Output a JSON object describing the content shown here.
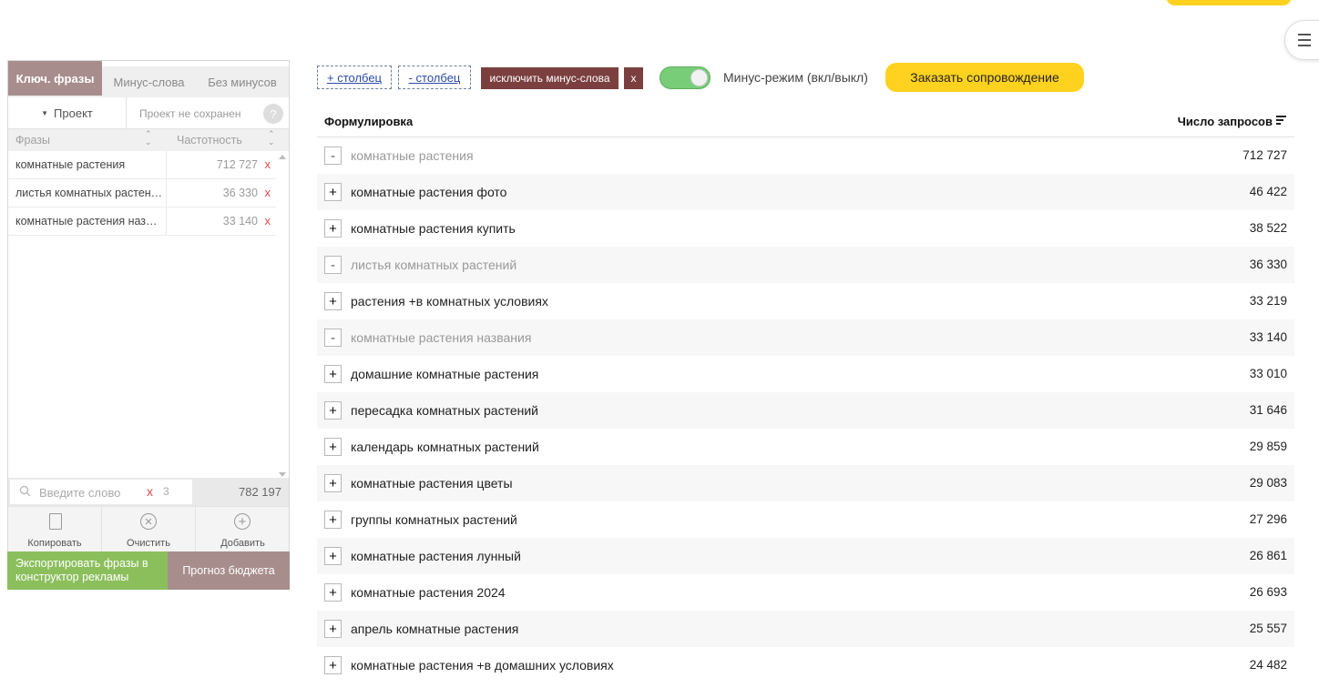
{
  "left_panel": {
    "tabs": [
      {
        "label": "Ключ. фразы",
        "active": true
      },
      {
        "label": "Минус-слова",
        "active": false
      },
      {
        "label": "Без минусов",
        "active": false
      }
    ],
    "project_button": "Проект",
    "project_status": "Проект не сохранен",
    "help": "?",
    "col_phrases": "Фразы",
    "col_frequency": "Частотность",
    "phrases": [
      {
        "text": "комнатные растения",
        "count": "712 727",
        "remove": "x"
      },
      {
        "text": "листья комнатных растений",
        "count": "36 330",
        "remove": "x"
      },
      {
        "text": "комнатные растения названия",
        "count": "33 140",
        "remove": "x"
      }
    ],
    "search": {
      "placeholder": "Введите слово",
      "clear": "x",
      "count": "3"
    },
    "total": "782 197",
    "actions": {
      "copy": "Копировать",
      "clear": "Очистить",
      "add": "Добавить"
    },
    "export_button": "Экспортировать фразы в конструктор рекламы",
    "budget_button": "Прогноз бюджета"
  },
  "toolbar": {
    "add_column": "+ столбец",
    "remove_column": "- столбец",
    "exclude_minus": "исключить минус-слова",
    "exclude_x": "x",
    "minus_mode_label": "Минус-режим (вкл/выкл)",
    "minus_mode_on": true,
    "order_button": "Заказать сопровождение"
  },
  "table": {
    "col_phrase": "Формулировка",
    "col_count": "Число запросов",
    "rows": [
      {
        "sign": "-",
        "phrase": "комнатные растения",
        "count": "712 727",
        "added": true
      },
      {
        "sign": "+",
        "phrase": "комнатные растения фото",
        "count": "46 422",
        "added": false
      },
      {
        "sign": "+",
        "phrase": "комнатные растения купить",
        "count": "38 522",
        "added": false
      },
      {
        "sign": "-",
        "phrase": "листья комнатных растений",
        "count": "36 330",
        "added": true
      },
      {
        "sign": "+",
        "phrase": "растения +в комнатных условиях",
        "count": "33 219",
        "added": false
      },
      {
        "sign": "-",
        "phrase": "комнатные растения названия",
        "count": "33 140",
        "added": true
      },
      {
        "sign": "+",
        "phrase": "домашние комнатные растения",
        "count": "33 010",
        "added": false
      },
      {
        "sign": "+",
        "phrase": "пересадка комнатных растений",
        "count": "31 646",
        "added": false
      },
      {
        "sign": "+",
        "phrase": "календарь комнатных растений",
        "count": "29 859",
        "added": false
      },
      {
        "sign": "+",
        "phrase": "комнатные растения цветы",
        "count": "29 083",
        "added": false
      },
      {
        "sign": "+",
        "phrase": "группы комнатных растений",
        "count": "27 296",
        "added": false
      },
      {
        "sign": "+",
        "phrase": "комнатные растения лунный",
        "count": "26 861",
        "added": false
      },
      {
        "sign": "+",
        "phrase": "комнатные растения 2024",
        "count": "26 693",
        "added": false
      },
      {
        "sign": "+",
        "phrase": "апрель комнатные растения",
        "count": "25 557",
        "added": false
      },
      {
        "sign": "+",
        "phrase": "комнатные растения +в домашних условиях",
        "count": "24 482",
        "added": false
      }
    ]
  },
  "colors": {
    "accent_brown": "#a88d8d",
    "dark_red": "#7b3f3f",
    "green": "#8bbf5c",
    "yellow": "#ffd21f"
  }
}
